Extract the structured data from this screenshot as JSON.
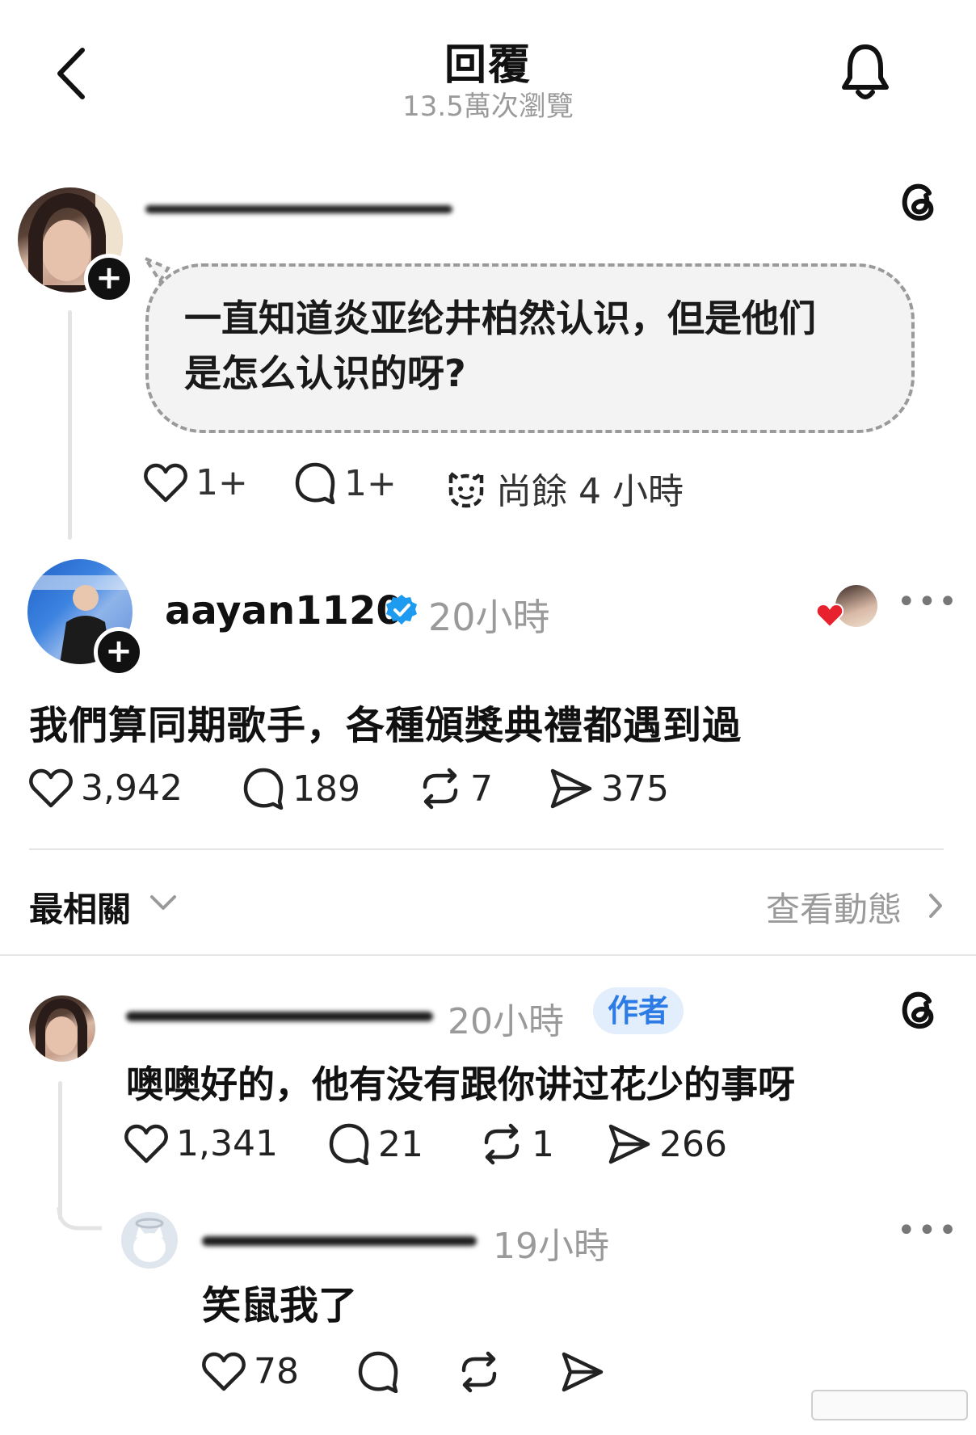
{
  "header": {
    "title": "回覆",
    "subtitle": "13.5萬次瀏覽"
  },
  "question_card": {
    "text_line1": "一直知道炎亚纶井柏然认识，但是他们",
    "text_line2": "是怎么认识的呀?",
    "likes": "1+",
    "replies": "1+",
    "time_remaining": "尚餘 4 小時"
  },
  "post": {
    "username": "aayan1120",
    "verified": true,
    "time": "20小時",
    "text": "我們算同期歌手，各種頒獎典禮都遇到過",
    "likes": "3,942",
    "replies": "189",
    "reposts": "7",
    "shares": "375"
  },
  "sort_bar": {
    "label": "最相關",
    "activity_link": "查看動態"
  },
  "replies": [
    {
      "time": "20小時",
      "badge": "作者",
      "text": "噢噢好的，他有没有跟你讲过花少的事呀",
      "likes": "1,341",
      "replies": "21",
      "reposts": "1",
      "shares": "266"
    },
    {
      "time": "19小時",
      "text": "笑鼠我了",
      "likes": "78"
    }
  ],
  "colors": {
    "verified_blue": "#1d9bf0",
    "author_badge_bg": "#e2eefc",
    "author_badge_text": "#2d7be4",
    "muted_text": "#9a9a9a",
    "heart_red": "#e8212e"
  },
  "icons": [
    "back-chevron-icon",
    "bell-icon",
    "threads-logo-icon",
    "heart-icon",
    "comment-icon",
    "repost-icon",
    "share-icon",
    "prompt-face-icon",
    "verified-icon",
    "more-icon",
    "chevron-down-icon",
    "chevron-right-icon"
  ]
}
